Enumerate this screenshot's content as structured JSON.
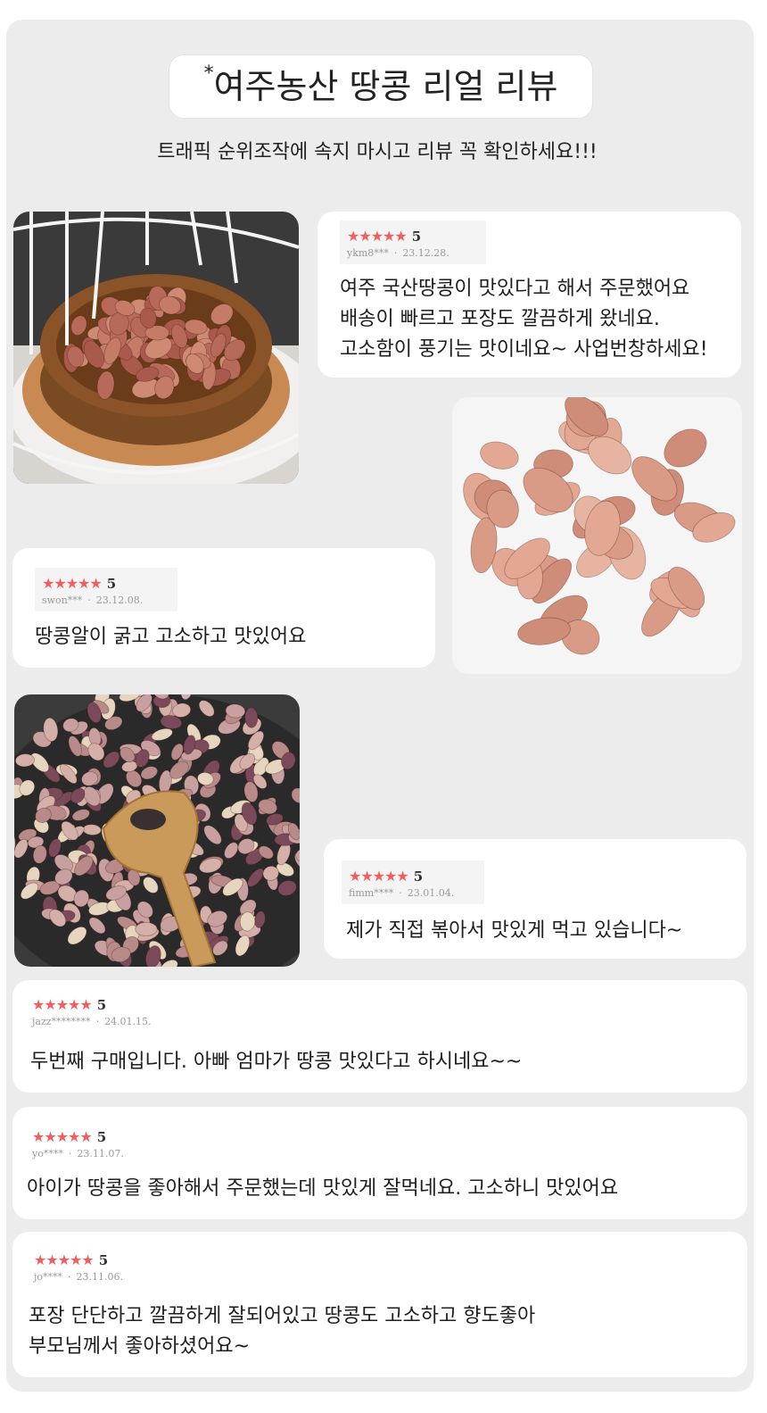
{
  "header": {
    "title_mark": "*",
    "title": "여주농산 땅콩 리얼 리뷰",
    "subtitle": "트래픽 순위조작에 속지 마시고 리뷰 꼭 확인하세요!!!"
  },
  "reviews": [
    {
      "stars": "★★★★★",
      "score": "5",
      "user": "ykm8***",
      "date": "23.12.28.",
      "lines": [
        "여주 국산땅콩이 맛있다고 해서 주문했어요",
        "배송이 빠르고 포장도 깔끔하게 왔네요.",
        "고소함이 풍기는 맛이네요~ 사업번창하세요!"
      ]
    },
    {
      "stars": "★★★★★",
      "score": "5",
      "user": "swon***",
      "date": "23.12.08.",
      "lines": [
        "땅콩알이 굵고 고소하고 맛있어요"
      ]
    },
    {
      "stars": "★★★★★",
      "score": "5",
      "user": "fimm****",
      "date": "23.01.04.",
      "lines": [
        "제가 직접 볶아서 맛있게 먹고 있습니다~"
      ]
    },
    {
      "stars": "★★★★★",
      "score": "5",
      "user": "jazz********",
      "date": "24.01.15.",
      "lines": [
        "두번째 구매입니다. 아빠 엄마가 땅콩 맛있다고 하시네요~~"
      ]
    },
    {
      "stars": "★★★★★",
      "score": "5",
      "user": "yo****",
      "date": "23.11.07.",
      "lines": [
        "아이가 땅콩을 좋아해서 주문했는데 맛있게 잘먹네요. 고소하니 맛있어요"
      ]
    },
    {
      "stars": "★★★★★",
      "score": "5",
      "user": "jo****",
      "date": "23.11.06.",
      "lines": [
        "포장 단단하고 깔끔하게 잘되어있고 땅콩도 고소하고 향도좋아",
        "부모님께서 좋아하셨어요~"
      ]
    }
  ],
  "photos": [
    {
      "name": "peanuts-in-wooden-bowl-photo"
    },
    {
      "name": "raw-peanuts-white-bowl-photo"
    },
    {
      "name": "roasting-peanuts-pan-photo"
    }
  ],
  "colors": {
    "star": "#ef5f5f",
    "panel": "#ececec",
    "card": "#ffffff"
  }
}
